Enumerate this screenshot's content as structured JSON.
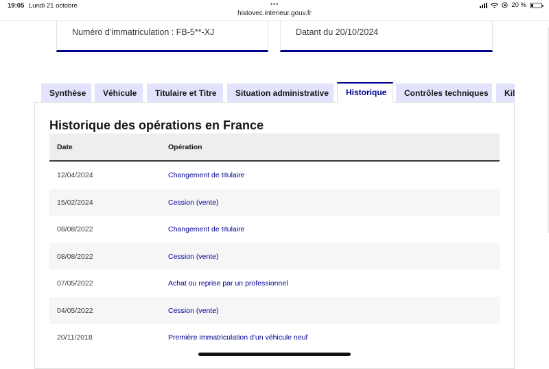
{
  "status_bar": {
    "time": "19:05",
    "date": "Lundi 21 octobre",
    "battery": "20 %",
    "battery_level": 0.2,
    "url": "histovec.interieur.gouv.fr"
  },
  "cards": {
    "registration": "Numéro d'immatriculation : FB-5**-XJ",
    "dated": "Datant du 20/10/2024"
  },
  "tabs": [
    {
      "label": "Synthèse"
    },
    {
      "label": "Véhicule"
    },
    {
      "label": "Titulaire et Titre"
    },
    {
      "label": "Situation administrative"
    },
    {
      "label": "Historique",
      "active": true
    },
    {
      "label": "Contrôles techniques"
    },
    {
      "label": "Kilo"
    }
  ],
  "panel": {
    "title": "Historique des opérations en France",
    "columns": [
      "Date",
      "Opération"
    ],
    "rows": [
      {
        "date": "12/04/2024",
        "operation": "Changement de titulaire"
      },
      {
        "date": "15/02/2024",
        "operation": "Cession (vente)"
      },
      {
        "date": "08/08/2022",
        "operation": "Changement de titulaire"
      },
      {
        "date": "08/08/2022",
        "operation": "Cession (vente)"
      },
      {
        "date": "07/05/2022",
        "operation": "Achat ou reprise par un professionnel"
      },
      {
        "date": "04/05/2022",
        "operation": "Cession (vente)"
      },
      {
        "date": "20/11/2018",
        "operation": "Première immatriculation d'un véhicule neuf"
      }
    ]
  },
  "colors": {
    "accent": "#000091",
    "tab_bg": "#e3e3fd",
    "stripe": "#f6f6f6",
    "header_bg": "#eeeeee"
  }
}
